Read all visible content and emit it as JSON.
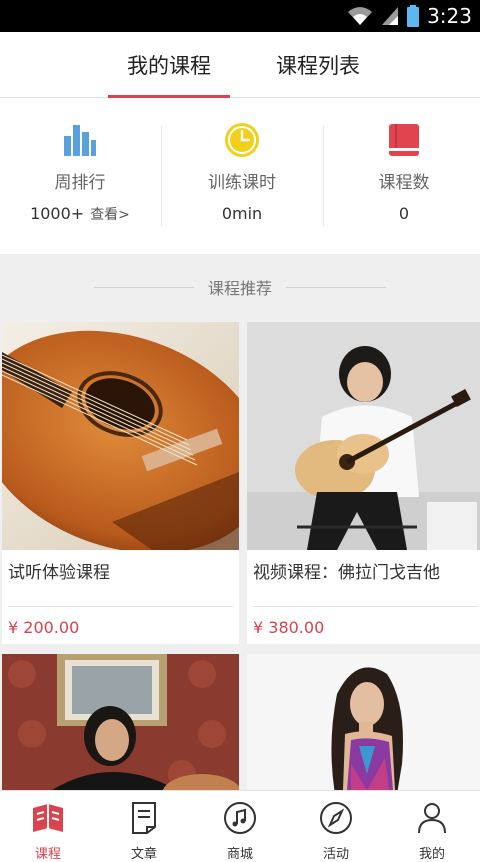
{
  "status_bar": {
    "time": "3:23"
  },
  "tabs": [
    {
      "label": "我的课程",
      "active": true
    },
    {
      "label": "课程列表",
      "active": false
    }
  ],
  "stats": [
    {
      "icon": "bar-chart-icon",
      "label": "周排行",
      "value": "1000+",
      "link": "查看>"
    },
    {
      "icon": "clock-icon",
      "label": "训练课时",
      "value": "0min"
    },
    {
      "icon": "book-icon",
      "label": "课程数",
      "value": "0"
    }
  ],
  "section": {
    "title": "课程推荐"
  },
  "courses": [
    {
      "title": "试听体验课程",
      "price": "¥ 200.00",
      "image": "guitar-closeup-image"
    },
    {
      "title": "视频课程：佛拉门戈吉他",
      "price": "¥ 380.00",
      "image": "guitarist-playing-image"
    },
    {
      "title": "",
      "price": "",
      "image": "man-with-guitar-image"
    },
    {
      "title": "",
      "price": "",
      "image": "woman-portrait-image"
    }
  ],
  "bottom_nav": [
    {
      "label": "课程",
      "icon": "course-book-icon",
      "active": true
    },
    {
      "label": "文章",
      "icon": "article-icon",
      "active": false
    },
    {
      "label": "商城",
      "icon": "music-note-icon",
      "active": false
    },
    {
      "label": "活动",
      "icon": "compass-icon",
      "active": false
    },
    {
      "label": "我的",
      "icon": "person-icon",
      "active": false
    }
  ],
  "colors": {
    "accent": "#d9434e",
    "stat_blue": "#5aa0dc",
    "stat_yellow": "#f2d019",
    "stat_red": "#e0444e"
  }
}
